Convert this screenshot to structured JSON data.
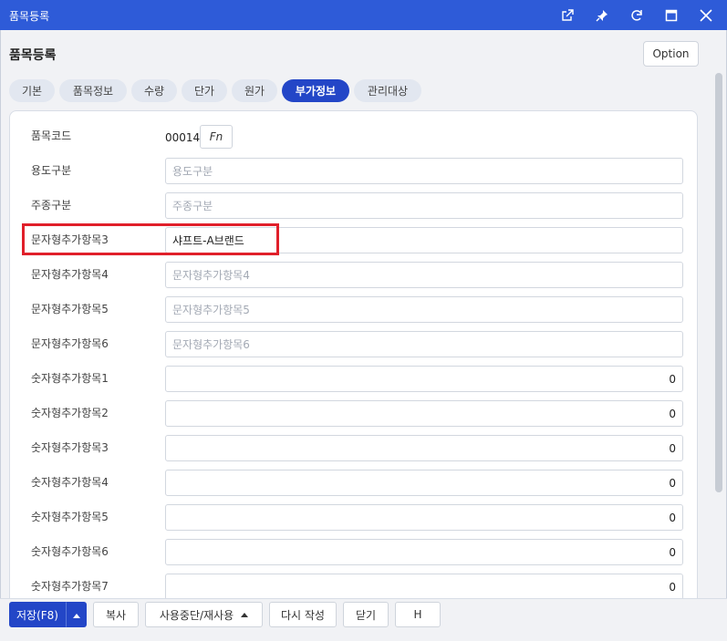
{
  "window": {
    "title": "품목등록"
  },
  "page": {
    "title": "품목등록",
    "option_label": "Option"
  },
  "tabs": [
    "기본",
    "품목정보",
    "수량",
    "단가",
    "원가",
    "부가정보",
    "관리대상"
  ],
  "active_tab": "부가정보",
  "item_code": {
    "label": "품목코드",
    "value": "00014",
    "fn_label": "Fn"
  },
  "fields": [
    {
      "label": "용도구분",
      "placeholder": "용도구분",
      "value": ""
    },
    {
      "label": "주종구분",
      "placeholder": "주종구분",
      "value": ""
    },
    {
      "label": "문자형추가항목3",
      "placeholder": "",
      "value": "샤프트-A브랜드"
    },
    {
      "label": "문자형추가항목4",
      "placeholder": "문자형추가항목4",
      "value": ""
    },
    {
      "label": "문자형추가항목5",
      "placeholder": "문자형추가항목5",
      "value": ""
    },
    {
      "label": "문자형추가항목6",
      "placeholder": "문자형추가항목6",
      "value": ""
    },
    {
      "label": "숫자형추가항목1",
      "placeholder": "",
      "value": "0"
    },
    {
      "label": "숫자형추가항목2",
      "placeholder": "",
      "value": "0"
    },
    {
      "label": "숫자형추가항목3",
      "placeholder": "",
      "value": "0"
    },
    {
      "label": "숫자형추가항목4",
      "placeholder": "",
      "value": "0"
    },
    {
      "label": "숫자형추가항목5",
      "placeholder": "",
      "value": "0"
    },
    {
      "label": "숫자형추가항목6",
      "placeholder": "",
      "value": "0"
    },
    {
      "label": "숫자형추가항목7",
      "placeholder": "",
      "value": "0"
    }
  ],
  "footer": {
    "save": "저장(F8)",
    "copy": "복사",
    "suspend": "사용중단/재사용",
    "rewrite": "다시 작성",
    "close": "닫기",
    "h": "H"
  },
  "icons": [
    "external-link-icon",
    "pin-icon",
    "refresh-icon",
    "maximize-icon",
    "close-icon"
  ],
  "colors": {
    "titlebar": "#2e5bd8",
    "primary": "#2346c7",
    "highlight": "#e01f2a"
  }
}
